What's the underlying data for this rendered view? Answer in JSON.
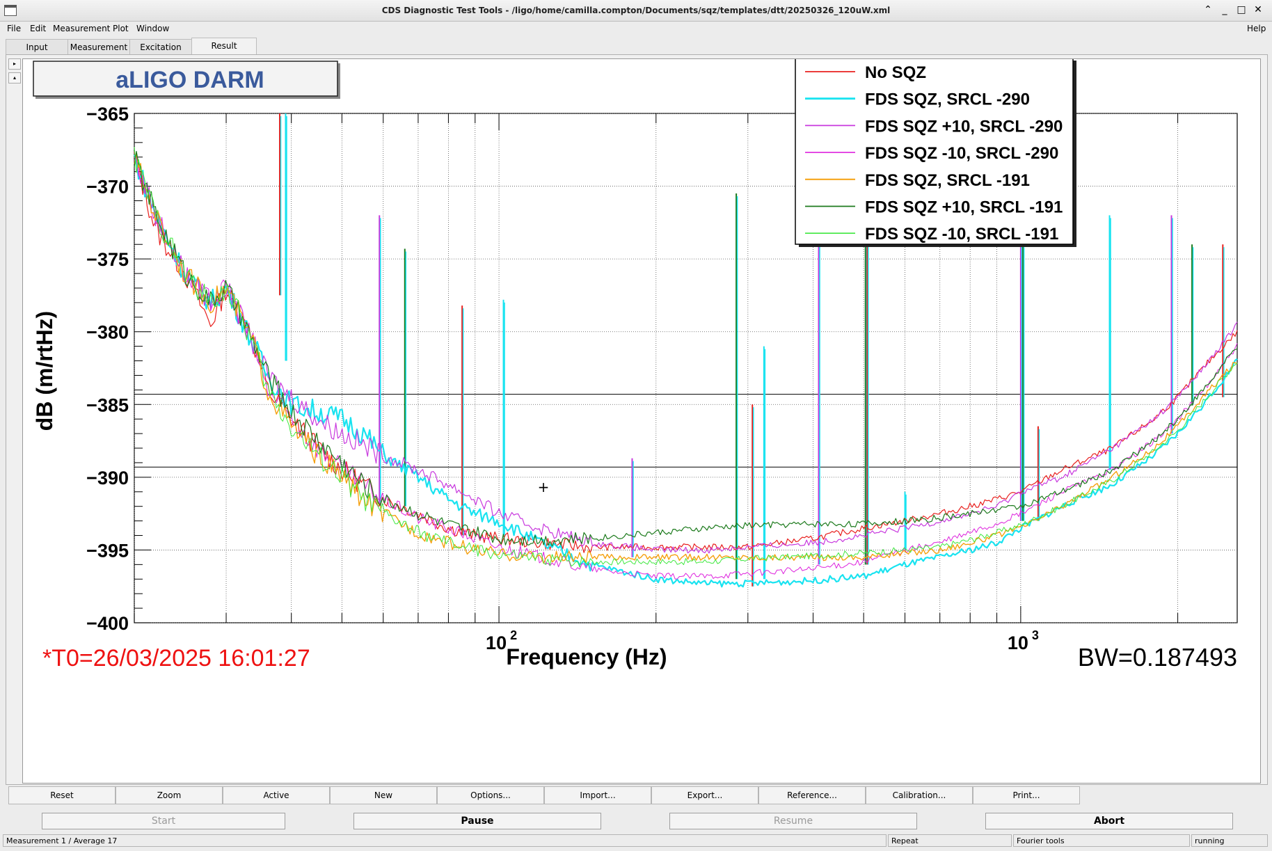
{
  "window": {
    "title": "CDS Diagnostic Test Tools - /ligo/home/camilla.compton/Documents/sqz/templates/dtt/20250326_120uW.xml",
    "controls": [
      "⌃",
      "_",
      "□",
      "✕"
    ]
  },
  "menu": {
    "items": [
      "File",
      "Edit",
      "Measurement",
      "Plot",
      "Window"
    ],
    "help": "Help"
  },
  "tabs": [
    "Input",
    "Measurement",
    "Excitation",
    "Result"
  ],
  "active_tab": "Result",
  "plot": {
    "banner": "aLIGO DARM",
    "timestamp": "*T0=26/03/2025 16:01:27",
    "bandwidth": "BW=0.187493",
    "cursor_marker": "+"
  },
  "chart_data": {
    "type": "line",
    "xlabel": "Frequency (Hz)",
    "ylabel": "dB (m/rtHz)",
    "x_scale": "log",
    "xlim": [
      20,
      2600
    ],
    "ylim": [
      -400,
      -365
    ],
    "y_ticks": [
      -365,
      -370,
      -375,
      -380,
      -385,
      -390,
      -395,
      -400
    ],
    "y_tick_labels": [
      "−365",
      "−370",
      "−375",
      "−380",
      "−385",
      "−390",
      "−395",
      "−400"
    ],
    "x_tick_labels": [
      {
        "base": "10",
        "exp": "2",
        "value": 100
      },
      {
        "base": "10",
        "exp": "3",
        "value": 1000
      }
    ],
    "grid": true,
    "legend_position": "top-right",
    "horizontal_markers": [
      -384.3,
      -389.3
    ],
    "lines": [
      {
        "x": 38,
        "y1": -365,
        "y2": -377.5
      },
      {
        "x": 39,
        "y1": -365,
        "y2": -382
      },
      {
        "x": 59,
        "y1": -372,
        "y2": -392
      },
      {
        "x": 66,
        "y1": -374.3,
        "y2": -392
      },
      {
        "x": 85,
        "y1": -378.2,
        "y2": -394
      },
      {
        "x": 102,
        "y1": -377.8,
        "y2": -394
      },
      {
        "x": 180,
        "y1": -388.7,
        "y2": -395.5
      },
      {
        "x": 285,
        "y1": -370.5,
        "y2": -397
      },
      {
        "x": 306,
        "y1": -385,
        "y2": -397.5
      },
      {
        "x": 322,
        "y1": -381,
        "y2": -397
      },
      {
        "x": 410,
        "y1": -372.7,
        "y2": -396
      },
      {
        "x": 504,
        "y1": -365,
        "y2": -396
      },
      {
        "x": 508,
        "y1": -365,
        "y2": -396
      },
      {
        "x": 600,
        "y1": -391,
        "y2": -395
      },
      {
        "x": 1000,
        "y1": -372,
        "y2": -393
      },
      {
        "x": 1010,
        "y1": -374,
        "y2": -393
      },
      {
        "x": 1080,
        "y1": -386.5,
        "y2": -393
      },
      {
        "x": 1480,
        "y1": -372,
        "y2": -389.5
      },
      {
        "x": 1945,
        "y1": -372,
        "y2": -387
      },
      {
        "x": 2130,
        "y1": -374,
        "y2": -385
      },
      {
        "x": 2440,
        "y1": -374,
        "y2": -384.5
      }
    ],
    "series": [
      {
        "name": "No SQZ",
        "color": "#e8201e",
        "width": 1.2,
        "x": [
          20,
          22,
          25,
          28,
          30,
          32,
          34,
          36,
          40,
          45,
          50,
          55,
          60,
          70,
          80,
          90,
          100,
          120,
          150,
          200,
          250,
          300,
          400,
          500,
          600,
          700,
          800,
          900,
          1000,
          1200,
          1500,
          1800,
          2000,
          2300,
          2600
        ],
        "y": [
          -368,
          -373,
          -376,
          -379.5,
          -377,
          -379,
          -381,
          -384,
          -386,
          -388,
          -389.5,
          -390.5,
          -391.5,
          -392.5,
          -393.5,
          -394,
          -394.2,
          -394.5,
          -394.8,
          -394.8,
          -394.8,
          -394.8,
          -394.2,
          -393.5,
          -393,
          -392.5,
          -392,
          -391.5,
          -391,
          -389.5,
          -388,
          -386,
          -384.5,
          -382,
          -380
        ]
      },
      {
        "name": "FDS SQZ, SRCL -290",
        "color": "#19e3f0",
        "width": 2.2,
        "x": [
          20,
          22,
          25,
          28,
          30,
          32,
          34,
          36,
          40,
          45,
          50,
          55,
          60,
          70,
          80,
          90,
          100,
          120,
          150,
          200,
          250,
          300,
          400,
          500,
          600,
          700,
          800,
          900,
          1000,
          1200,
          1500,
          1800,
          2000,
          2300,
          2600
        ],
        "y": [
          -368,
          -372,
          -376,
          -378,
          -377,
          -379,
          -381,
          -383,
          -385,
          -385.5,
          -386,
          -387,
          -388.5,
          -390,
          -391.5,
          -392.5,
          -393,
          -394.5,
          -396,
          -397,
          -397.3,
          -397.3,
          -397.1,
          -396.8,
          -396,
          -395.5,
          -395,
          -394.5,
          -393.5,
          -392,
          -390.5,
          -388.5,
          -387,
          -384.5,
          -382
        ]
      },
      {
        "name": "FDS SQZ +10, SRCL -290",
        "color": "#c839de",
        "width": 1.2,
        "x": [
          20,
          22,
          25,
          28,
          30,
          32,
          34,
          36,
          40,
          45,
          50,
          55,
          60,
          70,
          80,
          90,
          100,
          120,
          150,
          200,
          250,
          300,
          400,
          500,
          600,
          700,
          800,
          900,
          1000,
          1200,
          1500,
          1800,
          2000,
          2300,
          2600
        ],
        "y": [
          -368,
          -372,
          -376,
          -378,
          -377,
          -379,
          -381,
          -383,
          -384.5,
          -386,
          -387,
          -387.8,
          -388.5,
          -389.5,
          -390.5,
          -391.5,
          -392.5,
          -393.5,
          -394.5,
          -395,
          -395,
          -394.8,
          -394.5,
          -394,
          -393.5,
          -393,
          -392.5,
          -392,
          -391,
          -390,
          -388,
          -386,
          -384.5,
          -382,
          -379.5
        ]
      },
      {
        "name": "FDS SQZ -10, SRCL -290",
        "color": "#dd22dd",
        "width": 1.0,
        "x": [
          20,
          22,
          25,
          28,
          30,
          32,
          34,
          36,
          40,
          45,
          50,
          55,
          60,
          70,
          80,
          90,
          100,
          120,
          150,
          200,
          250,
          300,
          400,
          500,
          600,
          700,
          800,
          900,
          1000,
          1200,
          1500,
          1800,
          2000,
          2300,
          2600
        ],
        "y": [
          -368,
          -372,
          -376,
          -378,
          -377,
          -379,
          -381,
          -384,
          -386,
          -388,
          -389.5,
          -390.5,
          -391.5,
          -392.8,
          -393.5,
          -394.2,
          -394.8,
          -395.5,
          -396.3,
          -396.8,
          -396.8,
          -396.6,
          -396.3,
          -395.8,
          -395,
          -394.5,
          -393.8,
          -393.2,
          -392.5,
          -391,
          -389.5,
          -387.5,
          -386,
          -383.5,
          -381
        ]
      },
      {
        "name": "FDS SQZ, SRCL -191",
        "color": "#f5a00f",
        "width": 1.4,
        "x": [
          20,
          22,
          25,
          28,
          30,
          32,
          34,
          36,
          40,
          45,
          50,
          55,
          60,
          70,
          80,
          90,
          100,
          120,
          150,
          200,
          250,
          300,
          400,
          500,
          600,
          700,
          800,
          900,
          1000,
          1200,
          1500,
          1800,
          2000,
          2300,
          2600
        ],
        "y": [
          -368,
          -372,
          -376,
          -378,
          -377,
          -379,
          -381,
          -384,
          -386.5,
          -388.5,
          -390,
          -391.5,
          -392.5,
          -393.8,
          -394.5,
          -395,
          -395.3,
          -395.5,
          -395.5,
          -395.5,
          -395.5,
          -395.5,
          -395.5,
          -395.5,
          -395.2,
          -395,
          -394.5,
          -394,
          -393.5,
          -392,
          -390,
          -388,
          -386.5,
          -384,
          -382
        ]
      },
      {
        "name": "FDS SQZ +10, SRCL -191",
        "color": "#1c7a1c",
        "width": 1.2,
        "x": [
          20,
          22,
          25,
          28,
          30,
          32,
          34,
          36,
          40,
          45,
          50,
          55,
          60,
          70,
          80,
          90,
          100,
          120,
          150,
          200,
          250,
          300,
          400,
          500,
          600,
          700,
          800,
          900,
          1000,
          1200,
          1500,
          1800,
          2000,
          2300,
          2600
        ],
        "y": [
          -368,
          -372,
          -376,
          -378,
          -377,
          -379,
          -381,
          -383,
          -385.5,
          -387.5,
          -389,
          -390.5,
          -391.5,
          -392.5,
          -393.3,
          -393.8,
          -394.2,
          -394.3,
          -394.2,
          -393.8,
          -393.5,
          -393.3,
          -393.2,
          -393.2,
          -393,
          -392.8,
          -392.5,
          -392.2,
          -392,
          -391,
          -389.5,
          -387.5,
          -386,
          -383.5,
          -381
        ]
      },
      {
        "name": "FDS SQZ -10, SRCL -191",
        "color": "#3ee83e",
        "width": 1.0,
        "x": [
          20,
          22,
          25,
          28,
          30,
          32,
          34,
          36,
          40,
          45,
          50,
          55,
          60,
          70,
          80,
          90,
          100,
          120,
          150,
          200,
          250,
          300,
          400,
          500,
          600,
          700,
          800,
          900,
          1000,
          1200,
          1500,
          1800,
          2000,
          2300,
          2600
        ],
        "y": [
          -368,
          -372,
          -376,
          -378,
          -377,
          -379,
          -381,
          -384,
          -386.5,
          -388.5,
          -390,
          -391.5,
          -392.5,
          -393.8,
          -394.5,
          -395,
          -395.3,
          -395.6,
          -395.8,
          -395.8,
          -395.8,
          -395.6,
          -395.4,
          -395.2,
          -395,
          -394.8,
          -394.3,
          -393.8,
          -393.3,
          -392,
          -390.2,
          -388.2,
          -386.8,
          -384.3,
          -382
        ]
      }
    ]
  },
  "action_buttons": [
    "Reset",
    "Zoom",
    "Active",
    "New",
    "Options...",
    "Import...",
    "Export...",
    "Reference...",
    "Calibration...",
    "Print..."
  ],
  "controls": {
    "start": "Start",
    "pause": "Pause",
    "resume": "Resume",
    "abort": "Abort"
  },
  "status": {
    "measurement": "Measurement 1 / Average 17",
    "mode": "Repeat",
    "tool": "Fourier tools",
    "state": "running"
  },
  "side_buttons": [
    "▸",
    "▴"
  ]
}
